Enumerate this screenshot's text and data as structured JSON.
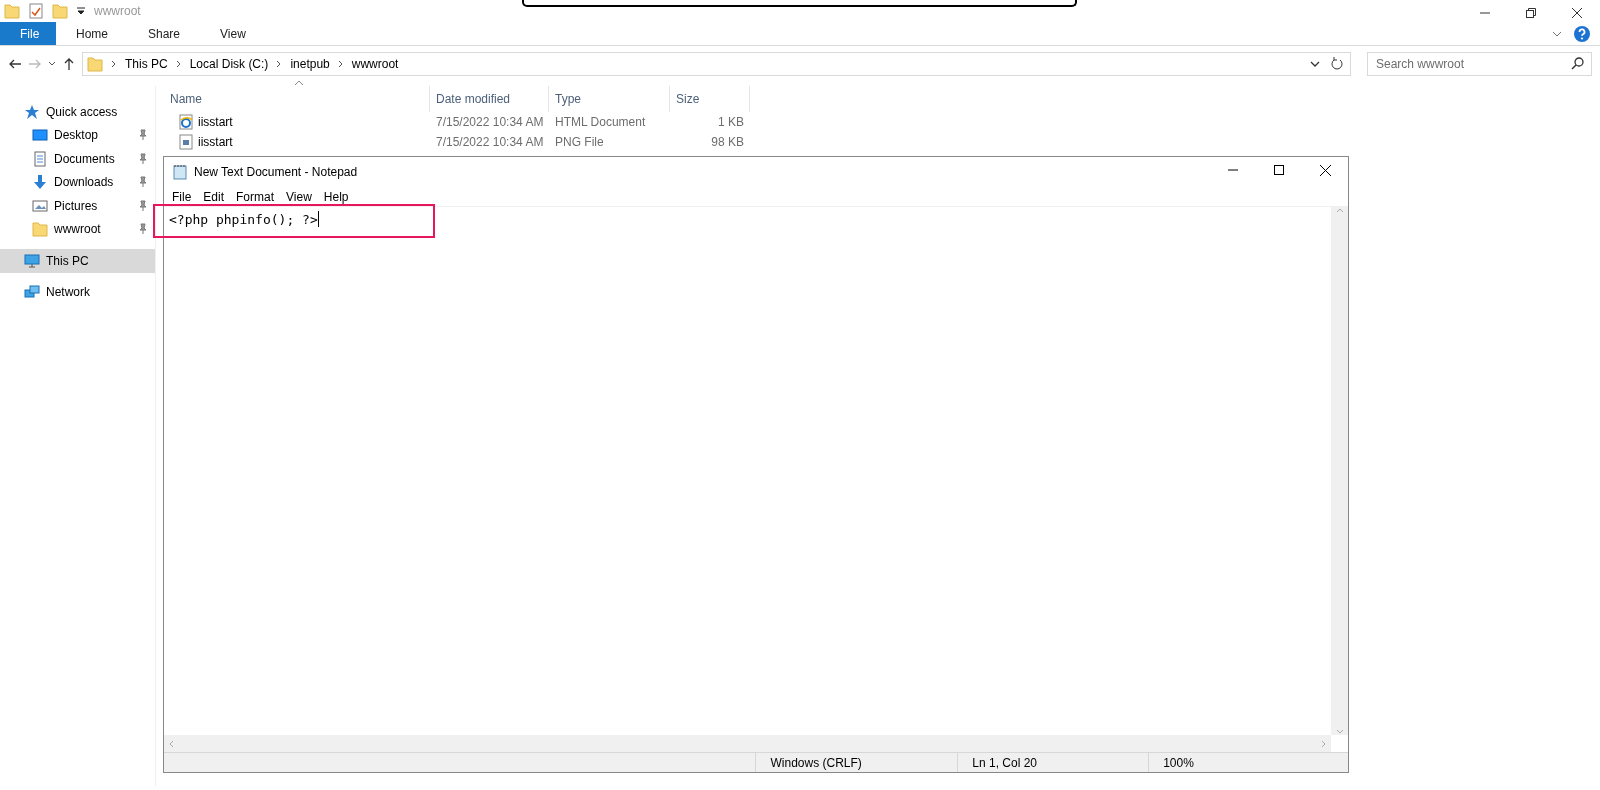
{
  "explorer": {
    "title": "wwwroot",
    "ribbon_tabs": [
      {
        "label": "File",
        "selected": true
      },
      {
        "label": "Home",
        "selected": false
      },
      {
        "label": "Share",
        "selected": false
      },
      {
        "label": "View",
        "selected": false
      }
    ],
    "breadcrumb": [
      "This PC",
      "Local Disk (C:)",
      "inetpub",
      "wwwroot"
    ],
    "search": {
      "placeholder": "Search wwwroot"
    },
    "sidebar": {
      "items": [
        {
          "label": "Quick access",
          "kind": "star",
          "pinned": false,
          "selected": false,
          "children": [
            {
              "label": "Desktop",
              "kind": "desktop",
              "pinned": true,
              "selected": false
            },
            {
              "label": "Documents",
              "kind": "documents",
              "pinned": true,
              "selected": false
            },
            {
              "label": "Downloads",
              "kind": "download",
              "pinned": true,
              "selected": false
            },
            {
              "label": "Pictures",
              "kind": "pictures",
              "pinned": true,
              "selected": false
            },
            {
              "label": "wwwroot",
              "kind": "folder",
              "pinned": true,
              "selected": false
            }
          ]
        },
        {
          "label": "This PC",
          "kind": "pc",
          "pinned": false,
          "selected": true
        },
        {
          "label": "Network",
          "kind": "network",
          "pinned": false,
          "selected": false
        }
      ]
    },
    "table": {
      "columns": [
        "Name",
        "Date modified",
        "Type",
        "Size"
      ],
      "rows": [
        {
          "kind": "html",
          "cells": [
            "iisstart",
            "7/15/2022 10:34 AM",
            "HTML Document",
            "1 KB"
          ]
        },
        {
          "kind": "image",
          "cells": [
            "iisstart",
            "7/15/2022 10:34 AM",
            "PNG File",
            "98 KB"
          ]
        }
      ]
    }
  },
  "notepad": {
    "title": "New Text Document - Notepad",
    "menu": [
      "File",
      "Edit",
      "Format",
      "View",
      "Help"
    ],
    "content": "<?php phpinfo(); ?>",
    "status_bar": [
      "Windows (CRLF)",
      "Ln 1, Col 20",
      "100%"
    ]
  }
}
